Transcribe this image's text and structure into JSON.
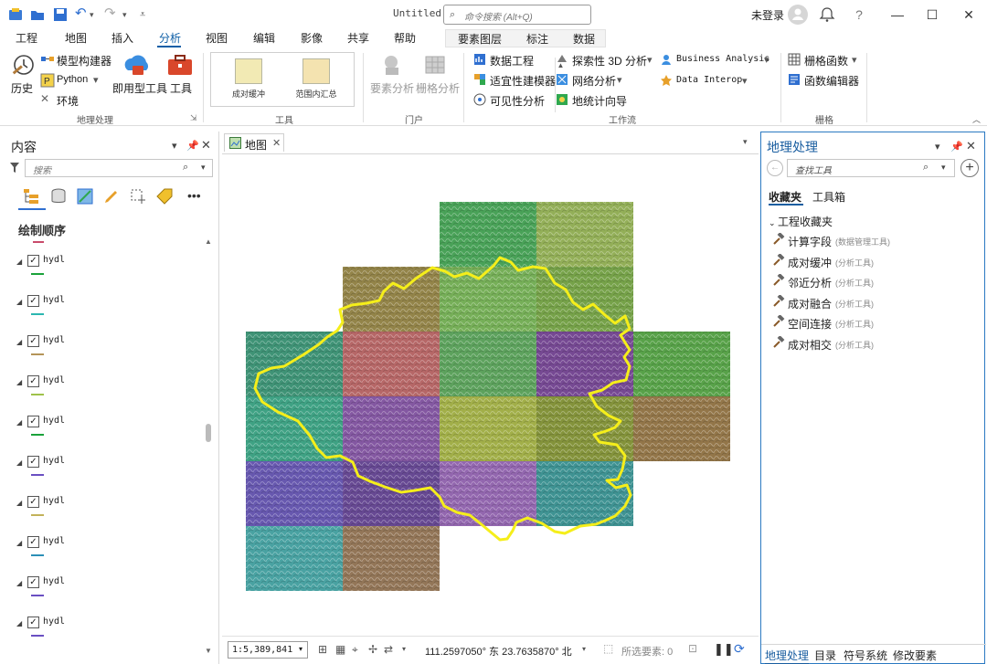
{
  "window": {
    "title": "Untitled",
    "command_search_placeholder": "命令搜索 (Alt+Q)",
    "login_text": "未登录",
    "help": "?"
  },
  "menu": {
    "tabs": [
      "工程",
      "地图",
      "插入",
      "分析",
      "视图",
      "编辑",
      "影像",
      "共享",
      "帮助"
    ],
    "active": "分析",
    "context_tabs": [
      "要素图层",
      "标注",
      "数据"
    ]
  },
  "ribbon": {
    "geoprocessing": {
      "history": "历史",
      "model_builder": "模型构建器",
      "python": "Python",
      "environment": "环境",
      "ready_to_use": "即用型工具",
      "tools": "工具",
      "group": "地理处理"
    },
    "tools_gallery": {
      "items": [
        "成对缓冲",
        "范围内汇总"
      ],
      "group": "工具"
    },
    "portal": {
      "feature_analysis": "要素分析",
      "raster_analysis": "栅格分析",
      "group": "门户"
    },
    "workflows": {
      "data_engineering": "数据工程",
      "exploratory_3d": "探索性 3D 分析",
      "business_analysis": "Business Analysis",
      "suitability_modeler": "适宜性建模器",
      "network_analysis": "网络分析",
      "data_interop": "Data Interop",
      "visibility_analysis": "可见性分析",
      "geostatistical_wizard": "地统计向导",
      "group": "工作流"
    },
    "raster": {
      "raster_functions": "栅格函数",
      "function_editor": "函数编辑器",
      "group": "栅格"
    }
  },
  "contents": {
    "title": "内容",
    "search_placeholder": "搜索",
    "draw_order_label": "绘制顺序",
    "layers": [
      {
        "name": "hydl",
        "checked": true,
        "color": "#1aa23a"
      },
      {
        "name": "hydl",
        "checked": true,
        "color": "#2bb7b0"
      },
      {
        "name": "hydl",
        "checked": true,
        "color": "#b49458"
      },
      {
        "name": "hydl",
        "checked": true,
        "color": "#9fc24a"
      },
      {
        "name": "hydl",
        "checked": true,
        "color": "#1aa23a"
      },
      {
        "name": "hydl",
        "checked": true,
        "color": "#6a4fc2"
      },
      {
        "name": "hydl",
        "checked": true,
        "color": "#c2b25a"
      },
      {
        "name": "hydl",
        "checked": true,
        "color": "#2b8fb7"
      },
      {
        "name": "hydl",
        "checked": true,
        "color": "#6a4fc2"
      },
      {
        "name": "hydl",
        "checked": true,
        "color": "#6a4fc2"
      }
    ]
  },
  "map": {
    "tab_label": "地图",
    "scale": "1:5,389,841",
    "coordinates": "111.2597050° 东 23.7635870° 北",
    "selected_features": "所选要素: 0",
    "boundary_color": "#f5ee1a"
  },
  "geoprocessing_pane": {
    "title": "地理处理",
    "search_placeholder": "查找工具",
    "tabs": [
      "收藏夹",
      "工具箱"
    ],
    "active_tab": "收藏夹",
    "favorites_header": "工程收藏夹",
    "tools": [
      {
        "name": "计算字段",
        "toolbox": "(数据管理工具)"
      },
      {
        "name": "成对缓冲",
        "toolbox": "(分析工具)"
      },
      {
        "name": "邻近分析",
        "toolbox": "(分析工具)"
      },
      {
        "name": "成对融合",
        "toolbox": "(分析工具)"
      },
      {
        "name": "空间连接",
        "toolbox": "(分析工具)"
      },
      {
        "name": "成对相交",
        "toolbox": "(分析工具)"
      }
    ],
    "bottom_tabs": [
      "地理处理",
      "目录",
      "符号系统",
      "修改要素"
    ],
    "active_bottom_tab": "地理处理"
  }
}
